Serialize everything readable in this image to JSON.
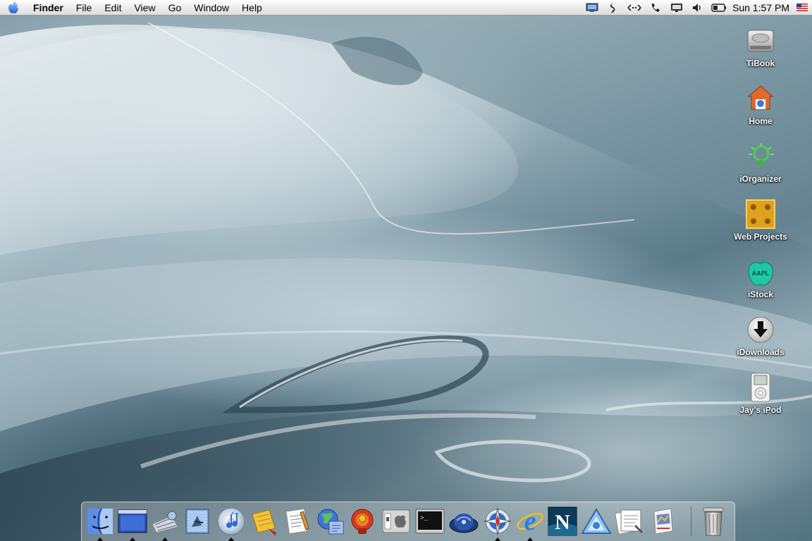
{
  "menubar": {
    "apple_icon": "apple-logo-icon",
    "app_name": "Finder",
    "menus": [
      "File",
      "Edit",
      "View",
      "Go",
      "Window",
      "Help"
    ],
    "extras": [
      "display-icon",
      "script-icon",
      "network-icon",
      "modem-icon",
      "screen-icon",
      "volume-icon",
      "battery-icon"
    ],
    "clock": "Sun 1:57 PM",
    "flag": "us-flag-icon"
  },
  "desktop": {
    "icons": [
      {
        "label": "TiBook",
        "icon": "hard-drive-icon"
      },
      {
        "label": "Home",
        "icon": "home-folder-icon"
      },
      {
        "label": "iOrganizer",
        "icon": "lightbulb-icon"
      },
      {
        "label": "Web Projects",
        "icon": "folder-box-icon"
      },
      {
        "label": "iStock",
        "icon": "aapl-apple-icon"
      },
      {
        "label": "iDownloads",
        "icon": "download-arrow-icon"
      },
      {
        "label": "Jay's iPod",
        "icon": "ipod-icon"
      }
    ],
    "aapl_text": "AAPL"
  },
  "dock": {
    "items": [
      "finder-icon",
      "desktop-window-icon",
      "sherlock-icon",
      "mail-icon",
      "itunes-icon",
      "stickies-icon",
      "textedit-icon",
      "network-utility-icon",
      "system-lock-icon",
      "apple-system-prefs-icon",
      "terminal-icon",
      "airport-icon",
      "compass-icon",
      "internet-explorer-icon",
      "netscape-icon",
      "triangle-app-icon",
      "preview-icon",
      "image-capture-icon",
      "trash-icon"
    ],
    "netscape_letter": "N",
    "ie_letter": "e",
    "terminal_prompt": ">_"
  }
}
